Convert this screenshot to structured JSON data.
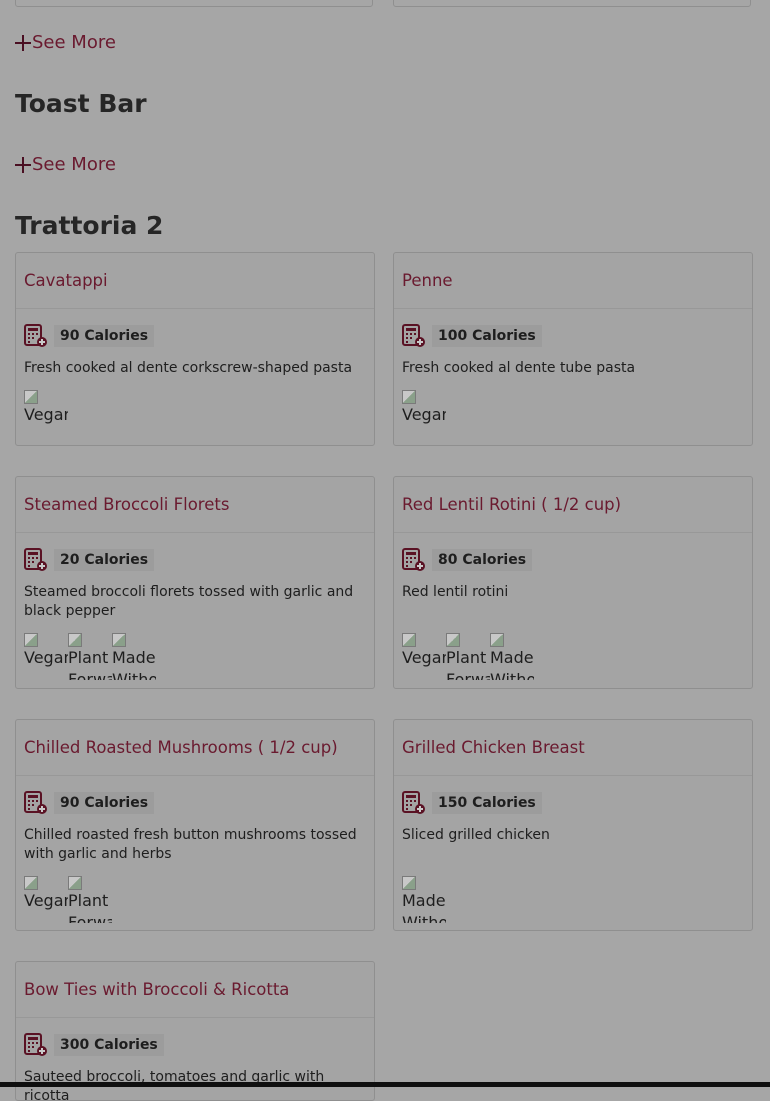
{
  "sections": {
    "prev_see_more": "See More",
    "toast_bar": {
      "title": "Toast Bar",
      "see_more": "See More"
    },
    "trattoria": {
      "title": "Trattoria 2"
    }
  },
  "cards": [
    {
      "name": "Cavatappi",
      "calories": "90 Calories",
      "desc": "Fresh cooked al dente corkscrew-shaped pasta",
      "tags": [
        "Vegan"
      ]
    },
    {
      "name": "Penne",
      "calories": "100 Calories",
      "desc": "Fresh cooked al dente tube pasta",
      "tags": [
        "Vegan"
      ]
    },
    {
      "name": "Steamed Broccoli Florets",
      "calories": "20 Calories",
      "desc": "Steamed broccoli florets tossed with garlic and black pepper",
      "tags": [
        "Vegan",
        "Plant Forward",
        "Made Without"
      ]
    },
    {
      "name": "Red Lentil Rotini ( 1/2 cup)",
      "calories": "80 Calories",
      "desc": "Red lentil rotini",
      "tags": [
        "Vegan",
        "Plant Forward",
        "Made Without"
      ]
    },
    {
      "name": "Chilled Roasted Mushrooms ( 1/2 cup)",
      "calories": "90 Calories",
      "desc": "Chilled roasted fresh button mushrooms tossed with garlic and herbs",
      "tags": [
        "Vegan",
        "Plant Forward"
      ]
    },
    {
      "name": "Grilled Chicken Breast",
      "calories": "150 Calories",
      "desc": "Sliced grilled chicken",
      "tags": [
        "Made Without"
      ]
    },
    {
      "name": "Bow Ties with Broccoli & Ricotta",
      "calories": "300 Calories",
      "desc": "Sauteed broccoli, tomatoes and garlic with ricotta",
      "tags": []
    }
  ]
}
